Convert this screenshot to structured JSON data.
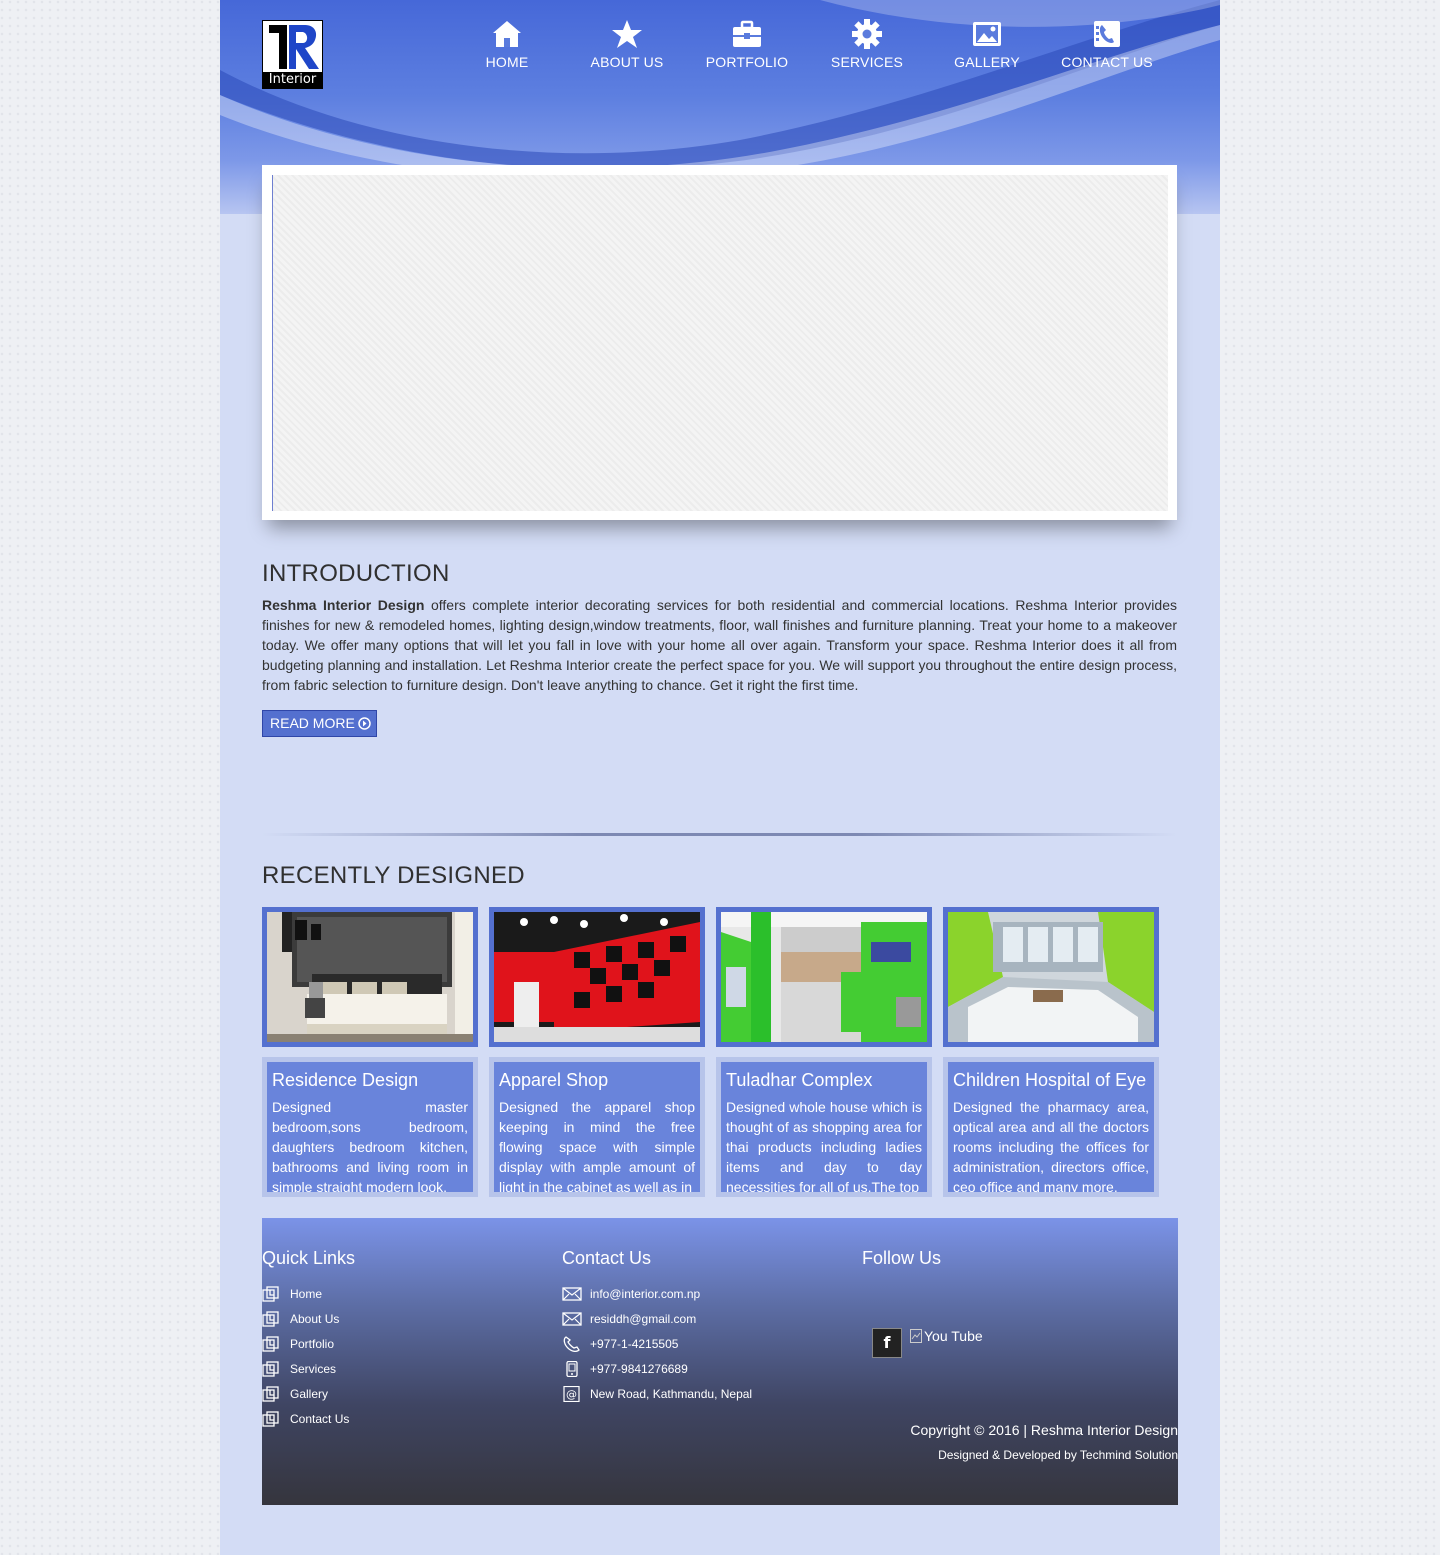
{
  "brand": {
    "logo_text": "Interior"
  },
  "nav": [
    {
      "label": "HOME",
      "icon": "home-icon"
    },
    {
      "label": "ABOUT US",
      "icon": "star-icon"
    },
    {
      "label": "PORTFOLIO",
      "icon": "briefcase-icon"
    },
    {
      "label": "SERVICES",
      "icon": "gear-icon"
    },
    {
      "label": "GALLERY",
      "icon": "image-icon"
    },
    {
      "label": "CONTACT US",
      "icon": "phone-icon"
    }
  ],
  "intro": {
    "heading": "INTRODUCTION",
    "bold_name": "Reshma Interior Design",
    "body": " offers complete interior decorating services for both residential and commercial locations. Reshma Interior provides finishes for new & remodeled homes, lighting design,window treatments, floor, wall finishes and furniture planning. Treat your home to a makeover today. We offer many options that will let you fall in love with your home all over again. Transform your space. Reshma Interior does it all from budgeting planning and installation. Let Reshma Interior create the perfect space for you. We will support you throughout the entire design process, from fabric selection to furniture design. Don't leave anything to chance. Get it right the first time.",
    "read_more": "READ MORE"
  },
  "recent": {
    "heading": "RECENTLY DESIGNED",
    "projects": [
      {
        "title": "Residence Design",
        "desc": "Designed master bedroom,sons bedroom, daughters bedroom kitchen, bathrooms and living room in simple straight modern look."
      },
      {
        "title": "Apparel Shop",
        "desc": "Designed the apparel shop keeping in mind the free flowing space with simple display with ample amount of light in the cabinet as well as in"
      },
      {
        "title": "Tuladhar Complex",
        "desc": "Designed whole house which is thought of as shopping area for thai products including ladies items and day to day necessities for all of us.The top"
      },
      {
        "title": "Children Hospital of Eye",
        "desc": "Designed the pharmacy area, optical area and all the doctors rooms including the offices for administration, directors office, ceo office and many more."
      }
    ]
  },
  "footer": {
    "quick_links_heading": "Quick Links",
    "quick_links": [
      "Home",
      "About Us",
      "Portfolio",
      "Services",
      "Gallery",
      "Contact Us"
    ],
    "contact_heading": "Contact Us",
    "contacts": [
      {
        "text": "info@interior.com.np",
        "icon": "mail-icon"
      },
      {
        "text": "residdh@gmail.com",
        "icon": "mail-icon"
      },
      {
        "text": "+977-1-4215505",
        "icon": "phone-icon"
      },
      {
        "text": "+977-9841276689",
        "icon": "mobile-icon"
      },
      {
        "text": "New Road, Kathmandu, Nepal",
        "icon": "at-icon"
      }
    ],
    "follow_heading": "Follow Us",
    "facebook_label": "f",
    "youtube_label": "You Tube",
    "copyright": "Copyright © 2016 | Reshma Interior Design",
    "credit": "Designed & Developed by Techmind Solution"
  },
  "colors": {
    "accent": "#5470cf",
    "header_top": "#4668d8",
    "page_bg": "#d3dcf5",
    "card_body": "#6984db"
  }
}
